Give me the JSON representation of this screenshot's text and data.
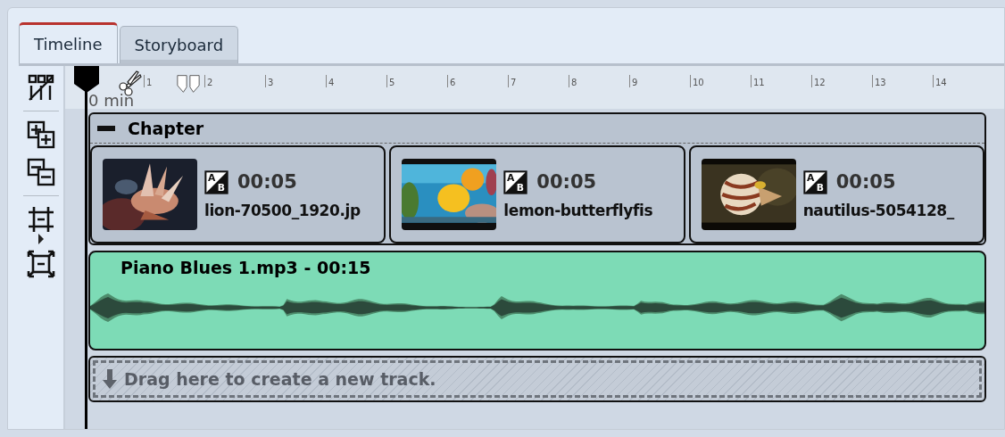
{
  "tabs": [
    {
      "label": "Timeline",
      "selected": true
    },
    {
      "label": "Storyboard",
      "selected": false
    }
  ],
  "ruler": {
    "start_label": "0 min",
    "ticks": [
      "1",
      "2",
      "3",
      "4",
      "5",
      "6",
      "7",
      "8",
      "9",
      "10",
      "11",
      "12",
      "13",
      "14"
    ]
  },
  "chapter": {
    "title": "Chapter",
    "expanded": true,
    "clips": [
      {
        "transition_letters": [
          "A",
          "B"
        ],
        "duration": "00:05",
        "name": "lion-70500_1920.jp",
        "picture": {
          "kind": "picture"
        }
      },
      {
        "transition_letters": [
          "A",
          "B"
        ],
        "duration": "00:05",
        "name": "lemon-butterflyfis",
        "picture": {
          "kind": "picture"
        }
      },
      {
        "transition_letters": [
          "A",
          "B"
        ],
        "duration": "00:05",
        "name": "nautilus-5054128_",
        "picture": {
          "kind": "picture"
        }
      }
    ]
  },
  "audio": {
    "title": "Piano Blues 1.mp3 - 00:15"
  },
  "drop_zone": {
    "text": "Drag here to create a new track."
  }
}
